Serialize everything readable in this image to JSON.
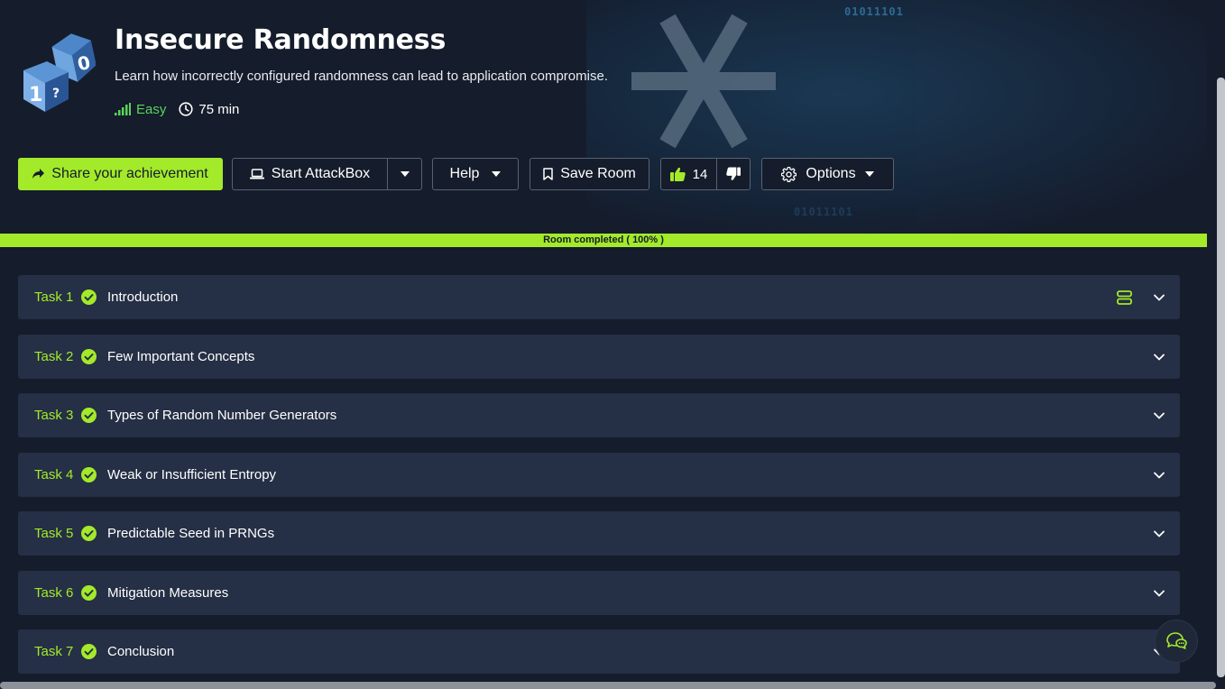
{
  "room": {
    "title": "Insecure Randomness",
    "description": "Learn how incorrectly configured randomness can lead to application compromise.",
    "difficulty": "Easy",
    "duration": "75 min",
    "background_text": [
      "01011101",
      "01011101"
    ]
  },
  "toolbar": {
    "share_label": "Share your achievement",
    "attackbox_label": "Start AttackBox",
    "help_label": "Help",
    "save_label": "Save Room",
    "upvotes": "14",
    "options_label": "Options"
  },
  "progress": {
    "label": "Room completed ( 100% )",
    "value": 1.0
  },
  "tasks": [
    {
      "number": "Task 1",
      "title": "Introduction",
      "completed": true
    },
    {
      "number": "Task 2",
      "title": "Few Important Concepts",
      "completed": true
    },
    {
      "number": "Task 3",
      "title": "Types of Random Number Generators",
      "completed": true
    },
    {
      "number": "Task 4",
      "title": "Weak or Insufficient Entropy",
      "completed": true
    },
    {
      "number": "Task 5",
      "title": "Predictable Seed in PRNGs",
      "completed": true
    },
    {
      "number": "Task 6",
      "title": "Mitigation Measures",
      "completed": true
    },
    {
      "number": "Task 7",
      "title": "Conclusion",
      "completed": true
    }
  ],
  "icons": {
    "room": "dice-icon",
    "difficulty": "signal-bars-icon",
    "duration": "clock-icon",
    "share": "share-arrow-icon",
    "attackbox": "laptop-icon",
    "save": "bookmark-icon",
    "upvote": "thumbs-up-icon",
    "downvote": "thumbs-down-icon",
    "options": "gear-icon",
    "task_done": "check-circle-icon",
    "task_expand": "chevron-down-icon",
    "layers": "layers-icon",
    "chat": "chat-icon"
  },
  "colors": {
    "accent": "#a3ea2a",
    "background": "#151c2b",
    "panel": "#252f45",
    "easy": "#5ad45a"
  }
}
